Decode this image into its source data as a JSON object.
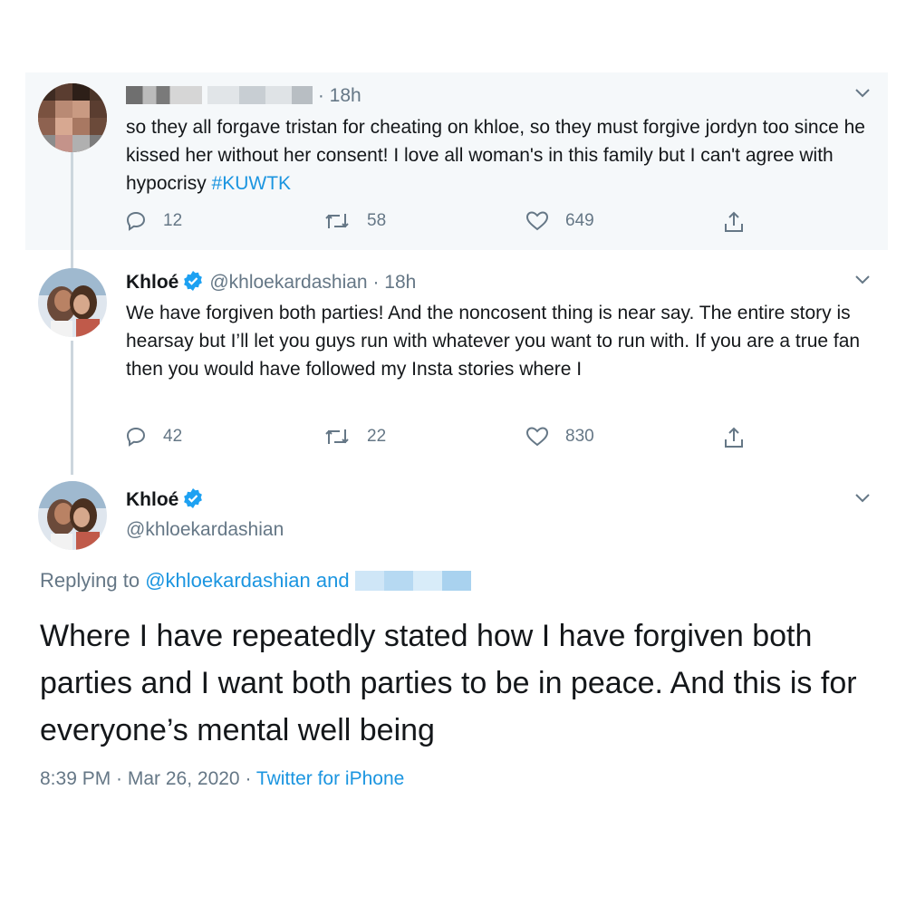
{
  "tweet1": {
    "time": "· 18h",
    "text": "so they all forgave tristan for cheating on khloe, so they must forgive jordyn too since he kissed her without her consent! I love all woman's in this family but I can't agree with hypocrisy ",
    "hashtag": "#KUWTK",
    "replies": "12",
    "retweets": "58",
    "likes": "649"
  },
  "tweet2": {
    "name": "Khloé",
    "handle": "@khloekardashian",
    "time": "· 18h",
    "text": "We have forgiven both parties! And the noncosent thing is near say. The entire story is hearsay but I’ll let you guys run with whatever you want to run with. If you are a true fan then you would have followed my Insta stories where I",
    "replies": "42",
    "retweets": "22",
    "likes": "830"
  },
  "tweet3": {
    "name": "Khloé",
    "handle": "@khloekardashian",
    "replying_prefix": "Replying to ",
    "replying_mention": "@khloekardashian and",
    "text": "Where I have repeatedly stated how I have forgiven both parties and I want both parties to be in peace. And this is for everyone’s mental well being",
    "time": "8:39 PM · Mar 26, 2020 · ",
    "source": "Twitter for iPhone"
  },
  "colors": {
    "accent": "#1b95e0",
    "muted": "#657786",
    "verified": "#1da1f2",
    "thread_bg": "#f5f8fa"
  },
  "icons": [
    "reply-icon",
    "retweet-icon",
    "like-icon",
    "share-icon",
    "chevron-down-icon",
    "verified-badge-icon"
  ]
}
